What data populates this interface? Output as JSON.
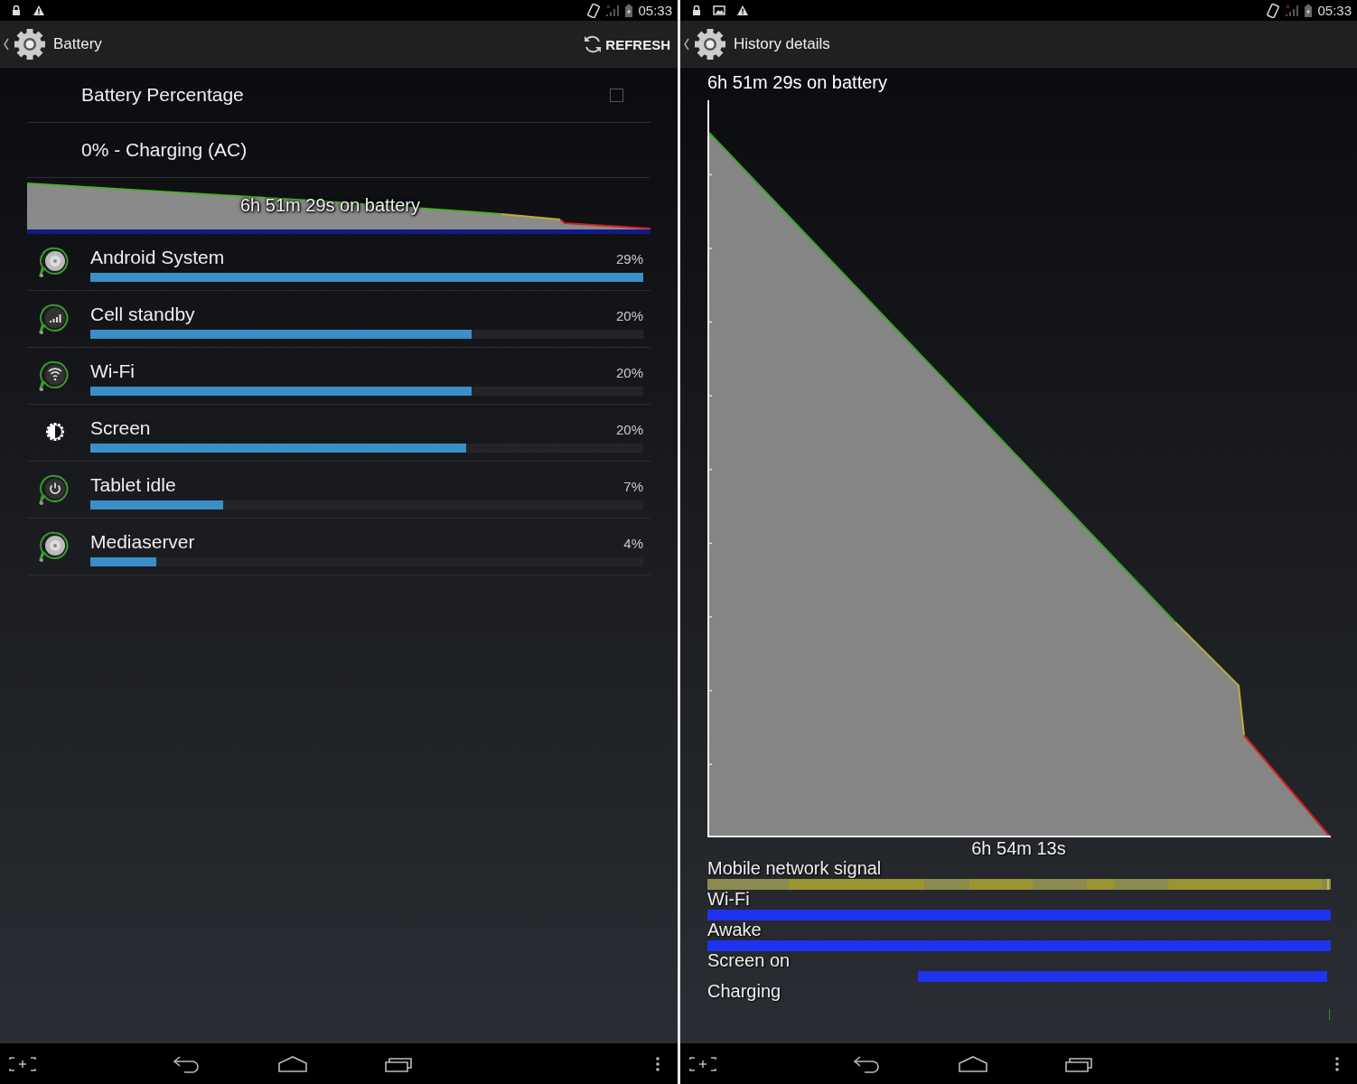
{
  "battery_screen": {
    "status_bar": {
      "time": "05:33"
    },
    "action_bar": {
      "title": "Battery",
      "refresh_label": "REFRESH"
    },
    "settings": [
      {
        "kind": "checkbox",
        "label": "Battery Percentage",
        "checked": false
      },
      {
        "kind": "text",
        "label": "0% - Charging (AC)"
      }
    ],
    "summary_graph": {
      "caption": "6h 51m 29s on battery"
    },
    "usage": [
      {
        "name": "Android System",
        "percent": "29%",
        "level": 1.0,
        "kind": "app"
      },
      {
        "name": "Cell standby",
        "percent": "20%",
        "level": 0.69,
        "kind": "radio"
      },
      {
        "name": "Wi-Fi",
        "percent": "20%",
        "level": 0.69,
        "kind": "wifi"
      },
      {
        "name": "Screen",
        "percent": "20%",
        "level": 0.68,
        "kind": "screen"
      },
      {
        "name": "Tablet idle",
        "percent": "7%",
        "level": 0.24,
        "kind": "idle"
      },
      {
        "name": "Mediaserver",
        "percent": "4%",
        "level": 0.12,
        "kind": "app"
      }
    ]
  },
  "history_screen": {
    "status_bar": {
      "time": "05:33"
    },
    "action_bar": {
      "title": "History details"
    },
    "graph_title": "6h 51m 29s on battery",
    "duration": "6h 54m 13s",
    "timelines": [
      {
        "label": "Mobile network signal",
        "kind": "signal"
      },
      {
        "label": "Wi-Fi",
        "kind": "full"
      },
      {
        "label": "Awake",
        "kind": "full"
      },
      {
        "label": "Screen on",
        "kind": "partial"
      },
      {
        "label": "Charging",
        "kind": "tick"
      }
    ]
  }
}
